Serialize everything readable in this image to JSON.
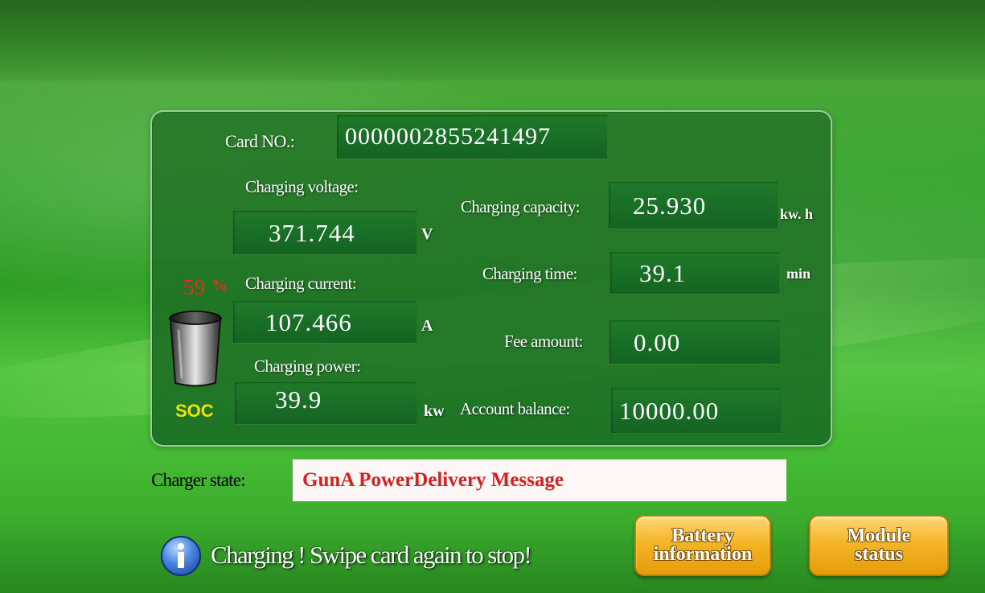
{
  "card": {
    "label": "Card NO.:",
    "value": "0000002855241497"
  },
  "voltage": {
    "label": "Charging voltage:",
    "value": "371.744",
    "unit": "V"
  },
  "current": {
    "label": "Charging current:",
    "value": "107.466",
    "unit": "A"
  },
  "power": {
    "label": "Charging power:",
    "value": "39.9",
    "unit": "kw"
  },
  "capacity": {
    "label": "Charging capacity:",
    "value": "25.930",
    "unit": "kw. h"
  },
  "time": {
    "label": "Charging time:",
    "value": "39.1",
    "unit": "min"
  },
  "fee": {
    "label": "Fee amount:",
    "value": "0.00"
  },
  "balance": {
    "label": "Account balance:",
    "value": "10000.00"
  },
  "soc": {
    "value": "59",
    "unit": "%",
    "label": "SOC",
    "level_percent": 59
  },
  "charger_state": {
    "label": "Charger state:",
    "value": "GunA PowerDelivery Message"
  },
  "message": {
    "text": "Charging ! Swipe card again to stop!"
  },
  "buttons": {
    "battery_info": "Battery\ninformation",
    "module_status": "Module\nstatus"
  },
  "colors": {
    "soc_value": "#e03020",
    "soc_label": "#f2e300",
    "state_text": "#d7201f",
    "button_orange": "#f4b526"
  },
  "icons": {
    "info": "info-icon",
    "battery": "battery-icon"
  }
}
